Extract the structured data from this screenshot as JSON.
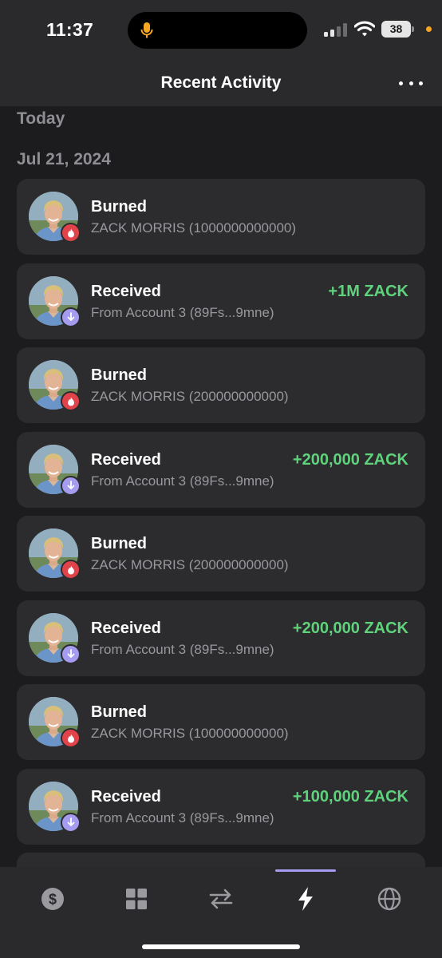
{
  "status_bar": {
    "time": "11:37",
    "battery": "38"
  },
  "header": {
    "title": "Recent Activity",
    "more_icon": "more-horizontal-icon"
  },
  "sections": {
    "today": "Today",
    "date": "Jul 21, 2024"
  },
  "activities": [
    {
      "type": "burn",
      "title": "Burned",
      "subtitle": "ZACK MORRIS (1000000000000)",
      "amount": ""
    },
    {
      "type": "receive",
      "title": "Received",
      "subtitle": "From Account 3 (89Fs...9mne)",
      "amount": "+1M ZACK"
    },
    {
      "type": "burn",
      "title": "Burned",
      "subtitle": "ZACK MORRIS (200000000000)",
      "amount": ""
    },
    {
      "type": "receive",
      "title": "Received",
      "subtitle": "From Account 3 (89Fs...9mne)",
      "amount": "+200,000 ZACK"
    },
    {
      "type": "burn",
      "title": "Burned",
      "subtitle": "ZACK MORRIS (200000000000)",
      "amount": ""
    },
    {
      "type": "receive",
      "title": "Received",
      "subtitle": "From Account 3 (89Fs...9mne)",
      "amount": "+200,000 ZACK"
    },
    {
      "type": "burn",
      "title": "Burned",
      "subtitle": "ZACK MORRIS (100000000000)",
      "amount": ""
    },
    {
      "type": "receive",
      "title": "Received",
      "subtitle": "From Account 3 (89Fs...9mne)",
      "amount": "+100,000 ZACK"
    }
  ],
  "tabs": [
    {
      "icon": "dollar-icon",
      "active": false
    },
    {
      "icon": "grid-icon",
      "active": false
    },
    {
      "icon": "swap-icon",
      "active": false
    },
    {
      "icon": "lightning-icon",
      "active": true
    },
    {
      "icon": "globe-icon",
      "active": false
    }
  ],
  "colors": {
    "accent": "#a59cf0",
    "burn": "#e0444a",
    "positive": "#5fd37c",
    "background": "#1c1c1e",
    "card": "#2c2c2e"
  }
}
